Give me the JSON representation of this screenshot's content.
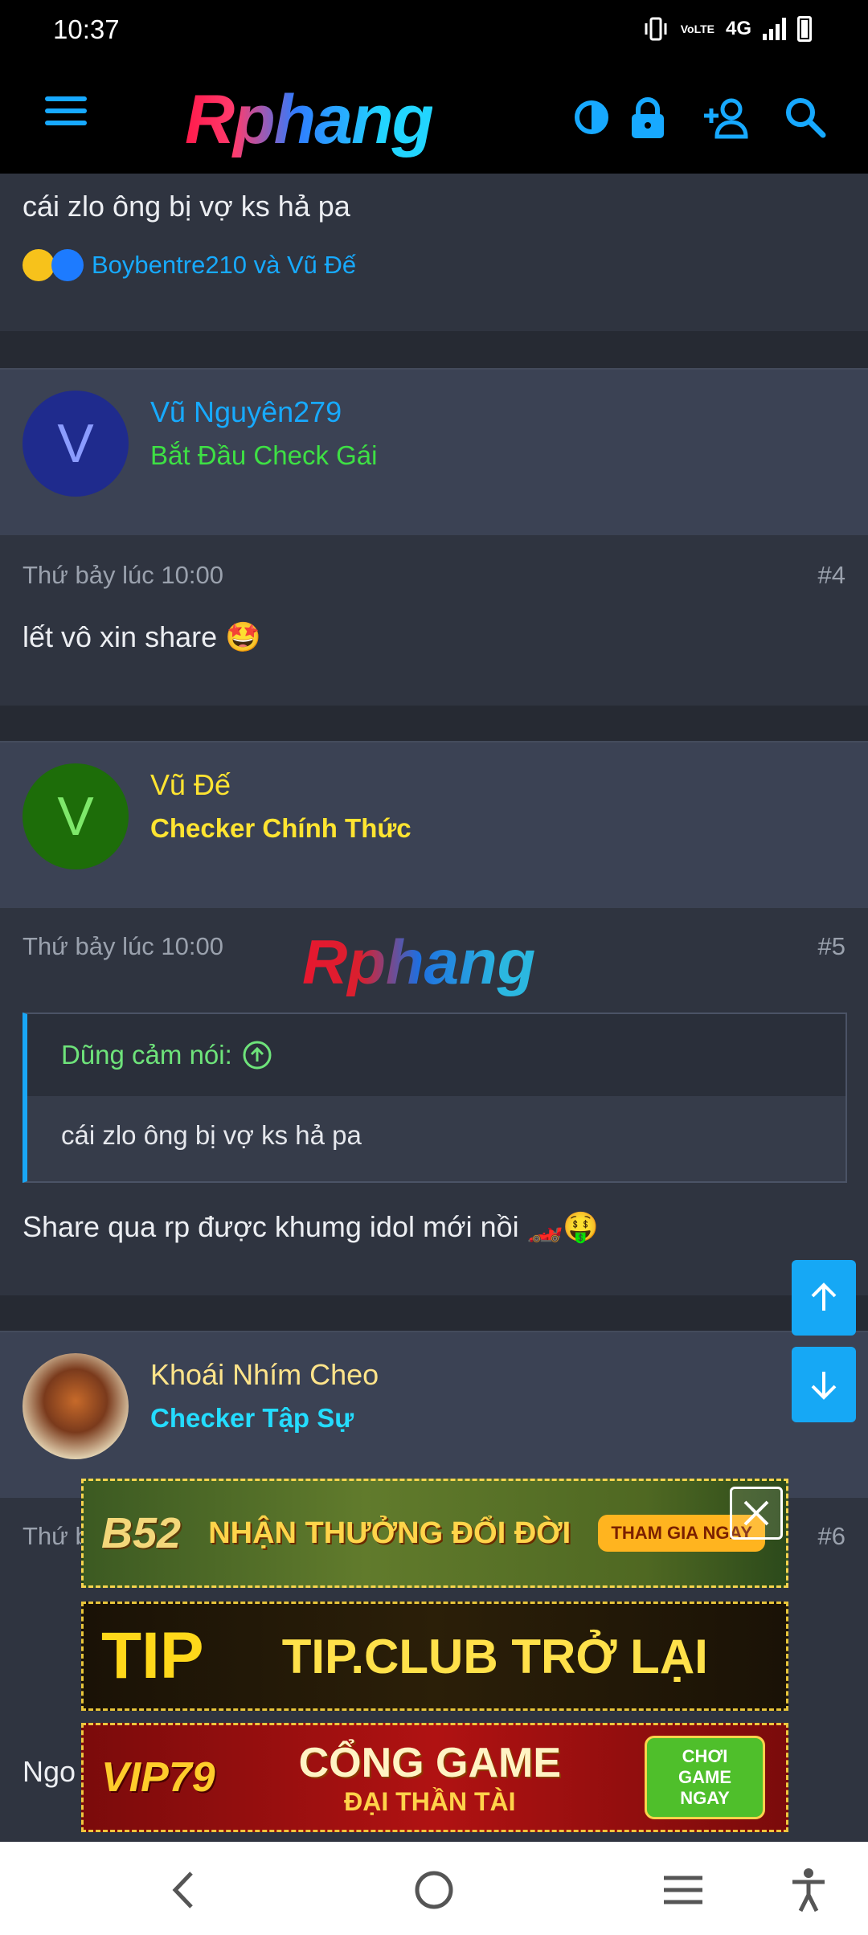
{
  "status": {
    "time": "10:37",
    "network": "4G",
    "volte": "VoLTE"
  },
  "header": {
    "logo": "Rphang"
  },
  "prev_post": {
    "message": "cái zlo ông bị vợ ks hả pa",
    "reactions_text": "Boybentre210 và Vũ Đế"
  },
  "posts": [
    {
      "avatar_letter": "V",
      "username": "Vũ Nguyên279",
      "user_title": "Bắt Đầu Check Gái",
      "date": "Thứ bảy lúc 10:00",
      "number": "#4",
      "message": "lết vô xin share 🤩"
    },
    {
      "avatar_letter": "V",
      "username": "Vũ Đế",
      "user_title": "Checker Chính Thức",
      "date": "Thứ bảy lúc 10:00",
      "number": "#5",
      "watermark": "Rphang",
      "quote_author": "Dũng cảm nói:",
      "quote_text": "cái zlo ông bị vợ ks hả pa",
      "message": "Share qua rp được khumg idol mới nồi 🏎️🤑"
    },
    {
      "username": "Khoái Nhím Cheo",
      "user_title": "Checker Tập Sự",
      "date": "Thứ b",
      "number": "#6",
      "message": "Ngo"
    }
  ],
  "ads": [
    {
      "left": "B52",
      "text": "NHẬN THƯỞNG ĐỔI ĐỜI",
      "cta": "THAM GIA NGAY"
    },
    {
      "left": "TIP",
      "text": "TIP.CLUB TRỞ LẠI"
    },
    {
      "left": "VIP79",
      "text": "CỔNG GAME",
      "text2": "ĐẠI THẦN TÀI",
      "cta": "CHƠI GAME NGAY"
    }
  ],
  "colors": {
    "accent": "#16a8f5",
    "user_blue": "#17aaff",
    "title_green": "#3ee044",
    "title_yellow": "#ffe431",
    "title_cyan": "#24dcff"
  }
}
